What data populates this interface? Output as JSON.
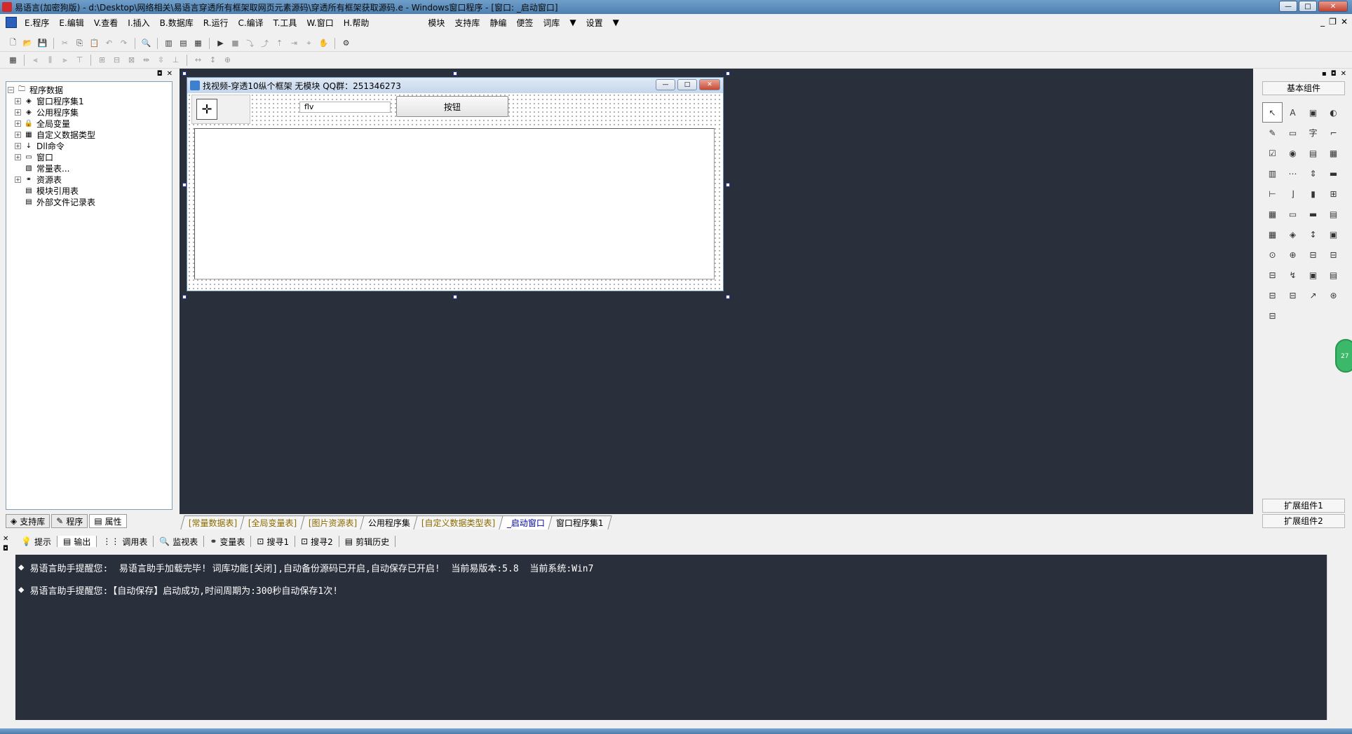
{
  "window": {
    "title": "易语言(加密狗版) - d:\\Desktop\\网络相关\\易语言穿透所有框架取网页元素源码\\穿透所有框架获取源码.e - Windows窗口程序 - [窗口: _启动窗口]"
  },
  "menu": {
    "items": [
      "E.程序",
      "E.编辑",
      "V.查看",
      "I.插入",
      "B.数据库",
      "R.运行",
      "C.编译",
      "T.工具",
      "W.窗口",
      "H.帮助"
    ],
    "extra": [
      "模块",
      "支持库",
      "静编",
      "便签",
      "词库",
      "▼",
      "设置",
      "▼"
    ]
  },
  "toolbar1": [
    "new",
    "open",
    "save",
    "cut",
    "copy",
    "paste",
    "undo",
    "redo",
    "find",
    "layout1",
    "layout2",
    "layout3",
    "run",
    "stop",
    "step1",
    "step2",
    "step3",
    "step4",
    "step5",
    "hand",
    "plugin"
  ],
  "toolbar2": [
    "grid",
    "align-left",
    "align-center",
    "align-right",
    "align-top",
    "align-middle",
    "align-bottom",
    "same-width",
    "same-height",
    "same-size",
    "hspace",
    "vspace",
    "center-h",
    "center-v",
    "lock"
  ],
  "tree": {
    "items": [
      {
        "label": "程序数据",
        "expander": "-",
        "icon": "folder-icon",
        "indent": 0
      },
      {
        "label": "窗口程序集1",
        "expander": "+",
        "icon": "stack-icon",
        "indent": 1
      },
      {
        "label": "公用程序集",
        "expander": "+",
        "icon": "stack-icon",
        "indent": 1
      },
      {
        "label": "全局变量",
        "expander": "+",
        "icon": "lock-icon",
        "indent": 1
      },
      {
        "label": "自定义数据类型",
        "expander": "+",
        "icon": "type-icon",
        "indent": 1
      },
      {
        "label": "Dll命令",
        "expander": "+",
        "icon": "dll-icon",
        "indent": 1
      },
      {
        "label": "窗口",
        "expander": "+",
        "icon": "window-icon",
        "indent": 1
      },
      {
        "label": "常量表...",
        "expander": "",
        "icon": "const-icon",
        "indent": 1
      },
      {
        "label": "资源表",
        "expander": "+",
        "icon": "resource-icon",
        "indent": 1
      },
      {
        "label": "模块引用表",
        "expander": "",
        "icon": "module-icon",
        "indent": 1
      },
      {
        "label": "外部文件记录表",
        "expander": "",
        "icon": "file-icon",
        "indent": 1
      }
    ]
  },
  "left_tabs": [
    "支持库",
    "程序",
    "属性"
  ],
  "editor_tabs": [
    {
      "label": "[常量数据表]",
      "style": "special"
    },
    {
      "label": "[全局变量表]",
      "style": "special"
    },
    {
      "label": "[图片资源表]",
      "style": "special"
    },
    {
      "label": "公用程序集",
      "style": "plain"
    },
    {
      "label": "[自定义数据类型表]",
      "style": "special"
    },
    {
      "label": "_启动窗口",
      "style": "active"
    },
    {
      "label": "窗口程序集1",
      "style": "plain"
    }
  ],
  "form": {
    "title": "找视频-穿透10纵个框架 无模块  QQ群：251346273",
    "edit_value": "flv",
    "button_label": "按钮"
  },
  "toolbox": {
    "title": "基本组件",
    "ext1": "扩展组件1",
    "ext2": "扩展组件2",
    "tools": [
      "↖",
      "A",
      "▣",
      "◐",
      "✎",
      "▭",
      "字",
      "⌐",
      "☑",
      "◉",
      "▤",
      "▦",
      "▥",
      "⋯",
      "⇕",
      "▬",
      "⊢",
      "⌋",
      "▮",
      "⊞",
      "▦",
      "▭",
      "▬",
      "▤",
      "▦",
      "◈",
      "↕",
      "▣",
      "⊙",
      "⊕",
      "⊟",
      "⊟",
      "⊟",
      "↯",
      "▣",
      "▤",
      "⊟",
      "⊟",
      "↗",
      "⊛",
      "⊟"
    ]
  },
  "bubble_text": "27",
  "bottom": {
    "tabs": [
      "提示",
      "输出",
      "调用表",
      "监视表",
      "变量表",
      "搜寻1",
      "搜寻2",
      "剪辑历史"
    ],
    "lines": [
      "易语言助手提醒您:  易语言助手加载完毕! 词库功能[关闭],自动备份源码已开启,自动保存已开启!  当前易版本:5.8  当前系统:Win7",
      "易语言助手提醒您:【自动保存】启动成功,时间周期为:300秒自动保存1次!"
    ]
  }
}
